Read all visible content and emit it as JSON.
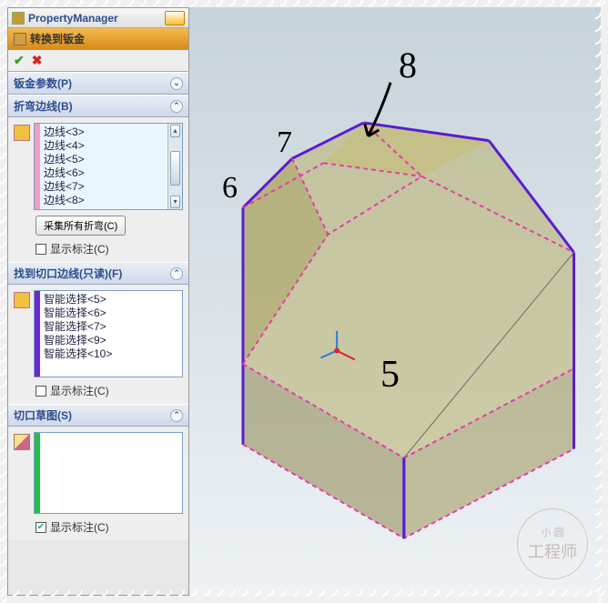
{
  "titlebar": {
    "title": "PropertyManager"
  },
  "header": {
    "command": "转换到钣金"
  },
  "sections": {
    "params": {
      "title": "钣金参数(P)"
    },
    "bend": {
      "title": "折弯边线(B)",
      "edges": [
        "边线<3>",
        "边线<4>",
        "边线<5>",
        "边线<6>",
        "边线<7>",
        "边线<8>"
      ],
      "collect_btn": "采集所有折弯(C)",
      "show_callout": "显示标注(C)",
      "show_callout_checked": false
    },
    "rip": {
      "title": "找到切口边线(只读)(F)",
      "items": [
        "智能选择<5>",
        "智能选择<6>",
        "智能选择<7>",
        "智能选择<9>",
        "智能选择<10>"
      ],
      "show_callout": "显示标注(C)",
      "show_callout_checked": false
    },
    "sketch": {
      "title": "切口草图(S)",
      "show_callout": "显示标注(C)",
      "show_callout_checked": true
    }
  },
  "annotations": {
    "a5": "5",
    "a6": "6",
    "a7": "7",
    "a8": "8"
  },
  "watermark": {
    "line1": "小 圆",
    "line2": "工程师"
  }
}
